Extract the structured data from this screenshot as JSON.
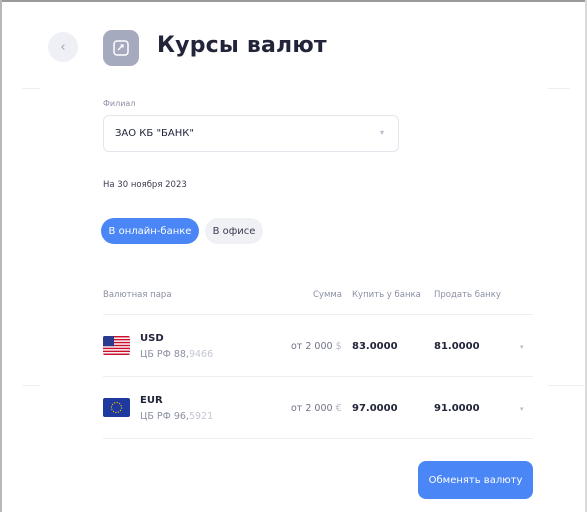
{
  "header": {
    "title": "Курсы валют",
    "back_icon": "chevron-left-icon",
    "title_icon": "exchange-icon"
  },
  "branch": {
    "label": "Филиал",
    "value": "ЗАО КБ \"БАНК\""
  },
  "date": {
    "text": "На 30 ноября 2023"
  },
  "tabs": [
    {
      "label": "В онлайн-банке",
      "active": true
    },
    {
      "label": "В офисе",
      "active": false
    }
  ],
  "table": {
    "headers": {
      "pair": "Валютная пара",
      "sum": "Сумма",
      "buy": "Купить у банка",
      "sell": "Продать банку"
    },
    "rows": [
      {
        "code": "USD",
        "rate_prefix": "ЦБ РФ 88,",
        "rate_suffix": "9466",
        "sum_prefix": "от 2 000 ",
        "sum_unit": "$",
        "buy": "83.0000",
        "sell": "81.0000",
        "flag": "us-flag-icon"
      },
      {
        "code": "EUR",
        "rate_prefix": "ЦБ РФ 96,",
        "rate_suffix": "5921",
        "sum_prefix": "от 2 000 ",
        "sum_unit": "€",
        "buy": "97.0000",
        "sell": "91.0000",
        "flag": "eu-flag-icon"
      }
    ]
  },
  "actions": {
    "exchange_label": "Обменять валюту"
  },
  "colors": {
    "accent": "#4a86f5",
    "tab_inactive": "#eff1f5",
    "title_icon_bg": "#a5aabe"
  }
}
